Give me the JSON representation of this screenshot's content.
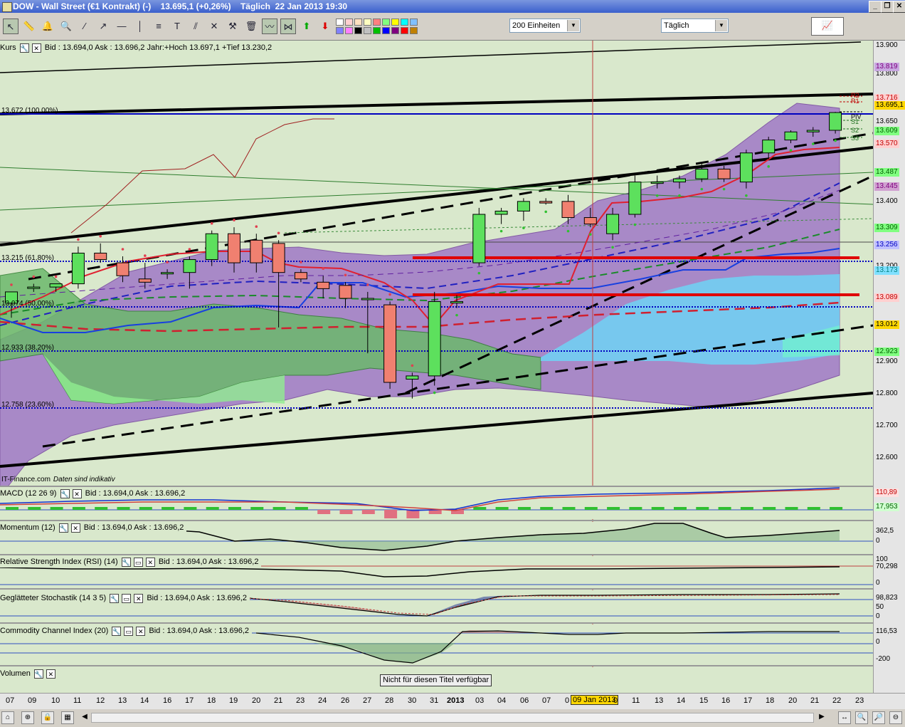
{
  "window": {
    "title": "DOW - Wall Street (€1 Kontrakt) (-)    13.695,1 (+0,26%)    Täglich  22 Jan 2013 19:30"
  },
  "toolbar": {
    "units_combo": "200 Einheiten",
    "period_combo": "Täglich",
    "tools": [
      "cursor-icon",
      "ruler-icon",
      "alarm-icon",
      "zoom-icon",
      "trendline-icon",
      "ray-icon",
      "horizontal-line-icon",
      "vertical-line-icon",
      "fibonacci-icon",
      "text-icon",
      "parallel-channel-icon",
      "tools-icon",
      "delete-icon",
      "chart-type-icon",
      "pattern-icon",
      "buy-arrow-icon",
      "sell-arrow-icon"
    ],
    "swatch_colors": [
      "#ffffff",
      "#ffd0d0",
      "#ffe0c0",
      "#ffffc0",
      "#ff8080",
      "#80ff80",
      "#ffff00",
      "#00ffff",
      "#80c0ff",
      "#8080ff",
      "#ff80ff",
      "#000000",
      "#c0c0c0",
      "#00c000",
      "#0000ff",
      "#800080",
      "#ff0000",
      "#c08000"
    ]
  },
  "price_panel": {
    "header_label": "Kurs",
    "header_text": "Bid : 13.694,0 Ask : 13.696,2 Jahr:+Hoch 13.697,1 +Tief 13.230,2",
    "fib_levels": [
      "13.672 (100,00%)",
      "13.215 (61,80%)",
      "13.074 (50,00%)",
      "12.933 (38,20%)",
      "12.758 (23,60%)"
    ],
    "axis_ticks": [
      "13.900",
      "13.800",
      "13.650",
      "13.400",
      "13.300",
      "13.200",
      "12.900",
      "12.800",
      "12.700",
      "12.600"
    ],
    "axis_boxes": [
      {
        "text": "13.819",
        "bg": "#c8a8e0",
        "fg": "#800080"
      },
      {
        "text": "13.716",
        "bg": "#ffd0d0",
        "fg": "#c00000"
      },
      {
        "text": "13.695,1",
        "bg": "#ffd700",
        "fg": "#000000"
      },
      {
        "text": "13.609",
        "bg": "#80ff80",
        "fg": "#006000"
      },
      {
        "text": "13.570",
        "bg": "#ffd0d0",
        "fg": "#c00000"
      },
      {
        "text": "13.487",
        "bg": "#80ff80",
        "fg": "#006000"
      },
      {
        "text": "13.445",
        "bg": "#d0a0d0",
        "fg": "#800080"
      },
      {
        "text": "13.309",
        "bg": "#80ff80",
        "fg": "#006000"
      },
      {
        "text": "13.256",
        "bg": "#c0c0ff",
        "fg": "#0000c0"
      },
      {
        "text": "13.173",
        "bg": "#80e0ff",
        "fg": "#008080"
      },
      {
        "text": "13.089",
        "bg": "#ffd0d0",
        "fg": "#c00000"
      },
      {
        "text": "13.012",
        "bg": "#ffd700",
        "fg": "#000000"
      },
      {
        "text": "12.923",
        "bg": "#80ff80",
        "fg": "#006000"
      }
    ],
    "pivot_labels": [
      "R2",
      "R1",
      "PIV",
      "S1",
      "S2",
      "S3"
    ],
    "credit": "IT-Finance.com",
    "credit_note": "Daten sind indikativ"
  },
  "indicators": [
    {
      "name": "MACD (12 26 9)",
      "text": "Bid : 13.694,0 Ask : 13.696,2",
      "values": [
        "110,89",
        "17,953"
      ]
    },
    {
      "name": "Momentum (12)",
      "text": "Bid : 13.694,0 Ask : 13.696,2",
      "values": [
        "362,5",
        "0"
      ]
    },
    {
      "name": "Relative Strength Index (RSI) (14)",
      "text": "Bid : 13.694,0 Ask : 13.696,2",
      "values": [
        "100",
        "70,298",
        "0"
      ]
    },
    {
      "name": "Geglätteter Stochastik (14 3 5)",
      "text": "Bid : 13.694,0 Ask : 13.696,2",
      "values": [
        "98,823",
        "50",
        "0"
      ]
    },
    {
      "name": "Commodity Channel Index (20)",
      "text": "Bid : 13.694,0 Ask : 13.696,2",
      "values": [
        "116,53",
        "0",
        "-200"
      ]
    },
    {
      "name": "Volumen",
      "text": "",
      "values": []
    }
  ],
  "volume_notice": "Nicht für diesen Titel verfügbar",
  "date_axis": [
    "07",
    "09",
    "10",
    "11",
    "12",
    "13",
    "14",
    "16",
    "17",
    "18",
    "19",
    "20",
    "21",
    "23",
    "24",
    "26",
    "27",
    "28",
    "30",
    "31",
    "2013",
    "03",
    "04",
    "06",
    "07",
    "0",
    "09 Jan 2013",
    "0",
    "11",
    "13",
    "14",
    "15",
    "16",
    "17",
    "18",
    "20",
    "21",
    "22",
    "23"
  ],
  "candles": [
    {
      "o": 13105,
      "h": 13140,
      "l": 13060,
      "c": 13140
    },
    {
      "o": 13155,
      "h": 13165,
      "l": 13140,
      "c": 13155
    },
    {
      "o": 13155,
      "h": 13165,
      "l": 13140,
      "c": 13165
    },
    {
      "o": 13165,
      "h": 13280,
      "l": 13150,
      "c": 13260
    },
    {
      "o": 13260,
      "h": 13290,
      "l": 13230,
      "c": 13240
    },
    {
      "o": 13230,
      "h": 13250,
      "l": 13170,
      "c": 13190
    },
    {
      "o": 13180,
      "h": 13230,
      "l": 13150,
      "c": 13170
    },
    {
      "o": 13200,
      "h": 13210,
      "l": 13180,
      "c": 13200
    },
    {
      "o": 13200,
      "h": 13250,
      "l": 13150,
      "c": 13240
    },
    {
      "o": 13240,
      "h": 13330,
      "l": 13220,
      "c": 13320
    },
    {
      "o": 13320,
      "h": 13340,
      "l": 13200,
      "c": 13230
    },
    {
      "o": 13300,
      "h": 13320,
      "l": 13200,
      "c": 13230
    },
    {
      "o": 13290,
      "h": 13300,
      "l": 13030,
      "c": 13200
    },
    {
      "o": 13200,
      "h": 13210,
      "l": 13170,
      "c": 13180
    },
    {
      "o": 13170,
      "h": 13190,
      "l": 13120,
      "c": 13150
    },
    {
      "o": 13160,
      "h": 13170,
      "l": 13090,
      "c": 13120
    },
    {
      "o": 13120,
      "h": 13140,
      "l": 12950,
      "c": 13120
    },
    {
      "o": 13100,
      "h": 13110,
      "l": 12840,
      "c": 12860
    },
    {
      "o": 12870,
      "h": 12890,
      "l": 12810,
      "c": 12880
    },
    {
      "o": 12880,
      "h": 13140,
      "l": 12850,
      "c": 13110
    },
    {
      "o": 13110,
      "h": 13130,
      "l": 13090,
      "c": 13110
    },
    {
      "o": 13230,
      "h": 13400,
      "l": 13220,
      "c": 13380
    },
    {
      "o": 13380,
      "h": 13400,
      "l": 13350,
      "c": 13390
    },
    {
      "o": 13390,
      "h": 13430,
      "l": 13360,
      "c": 13420
    },
    {
      "o": 13420,
      "h": 13430,
      "l": 13410,
      "c": 13415
    },
    {
      "o": 13420,
      "h": 13440,
      "l": 13350,
      "c": 13370
    },
    {
      "o": 13370,
      "h": 13400,
      "l": 13340,
      "c": 13350
    },
    {
      "o": 13320,
      "h": 13400,
      "l": 13300,
      "c": 13380
    },
    {
      "o": 13380,
      "h": 13500,
      "l": 13370,
      "c": 13480
    },
    {
      "o": 13480,
      "h": 13500,
      "l": 13460,
      "c": 13480
    },
    {
      "o": 13480,
      "h": 13500,
      "l": 13460,
      "c": 13490
    },
    {
      "o": 13490,
      "h": 13540,
      "l": 13480,
      "c": 13520
    },
    {
      "o": 13520,
      "h": 13530,
      "l": 13480,
      "c": 13490
    },
    {
      "o": 13480,
      "h": 13580,
      "l": 13460,
      "c": 13570
    },
    {
      "o": 13570,
      "h": 13620,
      "l": 13550,
      "c": 13610
    },
    {
      "o": 13610,
      "h": 13640,
      "l": 13600,
      "c": 13635
    },
    {
      "o": 13635,
      "h": 13650,
      "l": 13620,
      "c": 13640
    },
    {
      "o": 13640,
      "h": 13697,
      "l": 13630,
      "c": 13695
    }
  ]
}
